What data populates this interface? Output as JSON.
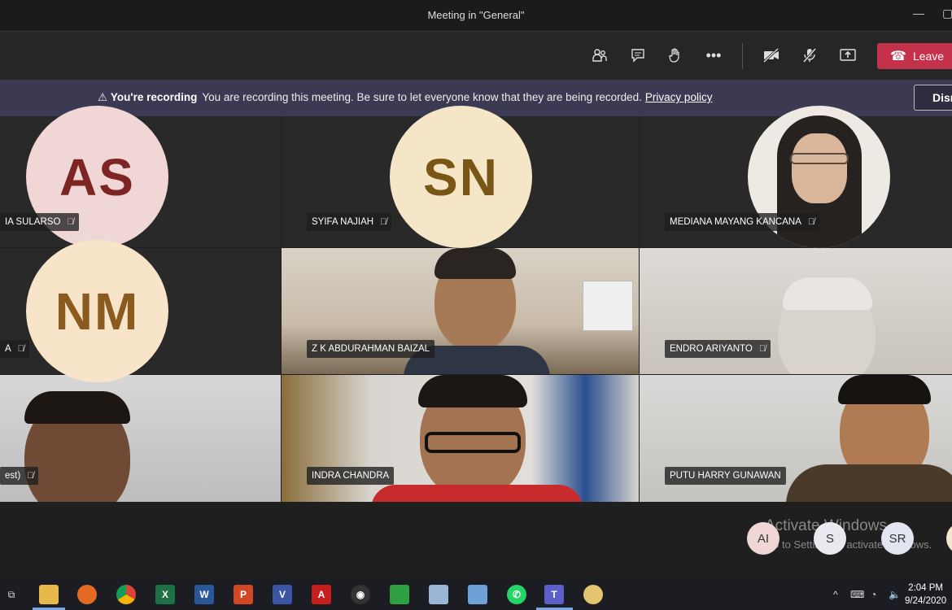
{
  "window": {
    "title": "Meeting in \"General\""
  },
  "toolbar": {
    "icons": [
      "participants-icon",
      "chat-icon",
      "raise-hand-icon",
      "more-icon",
      "camera-off-icon",
      "mic-off-icon",
      "share-icon"
    ],
    "leave_label": "Leave"
  },
  "banner": {
    "title": "You're recording",
    "message": "You are recording this meeting. Be sure to let everyone know that they are being recorded.",
    "link": "Privacy policy",
    "dismiss_label": "Dism"
  },
  "participants": {
    "t1": {
      "initials": "AS",
      "name": "IA SULARSO",
      "color": "#f1d6d6",
      "text_color": "#7d2525"
    },
    "t2": {
      "initials": "SN",
      "name": "SYIFA NAJIAH",
      "color": "#f6e6c8",
      "text_color": "#7a5616"
    },
    "t3": {
      "name": "MEDIANA MAYANG KANCANA"
    },
    "t4": {
      "initials": "NM",
      "name": "A",
      "color": "#f8e4c9",
      "text_color": "#8a5a1e"
    },
    "t5": {
      "name": "Z K ABDURAHMAN BAIZAL"
    },
    "t6": {
      "name": "ENDRO ARIYANTO"
    },
    "t7": {
      "name": "est)"
    },
    "t8": {
      "name": "INDRA CHANDRA"
    },
    "t9": {
      "name": "PUTU HARRY GUNAWAN"
    }
  },
  "tray_avatars": [
    {
      "initials": "AI",
      "color": "#f1d6d6"
    },
    {
      "initials": "S",
      "color": "#e9e9ef"
    },
    {
      "initials": "SR",
      "color": "#e3e6f1"
    }
  ],
  "watermark": {
    "line1": "Activate Windows",
    "line2": "Go to Settings to activate Windows."
  },
  "taskbar": {
    "apps": [
      "task-view-icon",
      "file-explorer-icon",
      "firefox-icon",
      "chrome-icon",
      "excel-icon",
      "word-icon",
      "powerpoint-icon",
      "visio-icon",
      "acrobat-icon",
      "obs-icon",
      "app-green-icon",
      "paint-icon",
      "notepad-icon",
      "whatsapp-icon",
      "teams-icon",
      "paint-palette-icon"
    ],
    "time": "2:04 PM",
    "date": "9/24/2020"
  }
}
